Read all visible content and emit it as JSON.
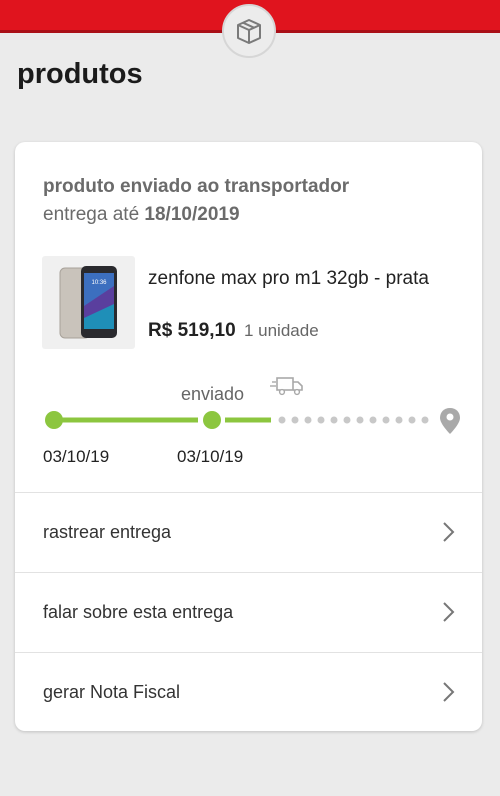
{
  "header": {
    "title": "produtos",
    "badge_icon": "package-box-icon",
    "accent_color": "#e0141e"
  },
  "order": {
    "status": "produto enviado ao transportador",
    "delivery_prefix": "entrega até",
    "delivery_date": "18/10/2019",
    "product_name": "zenfone max pro m1 32gb - prata",
    "price": "R$ 519,10",
    "quantity": "1 unidade",
    "timeline": {
      "current_step_label": "enviado",
      "step1_date": "03/10/19",
      "step2_date": "03/10/19",
      "progress_color": "#8cc63f",
      "pending_color": "#c8c8c8"
    }
  },
  "actions": [
    {
      "label": "rastrear entrega"
    },
    {
      "label": "falar sobre esta entrega"
    },
    {
      "label": "gerar Nota Fiscal"
    }
  ]
}
